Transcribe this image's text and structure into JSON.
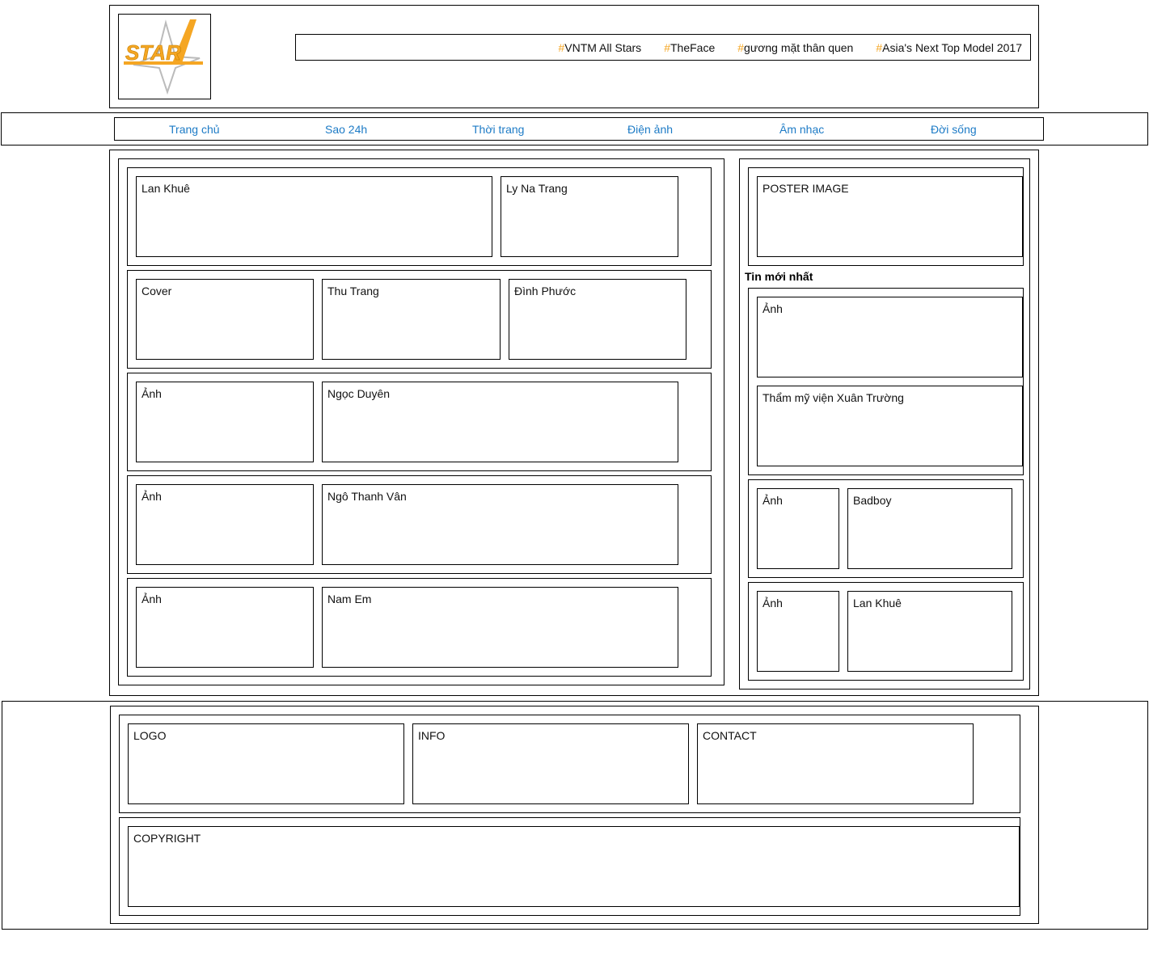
{
  "header": {
    "logo_text": "STAR",
    "hashtags": [
      "VNTM All Stars",
      "TheFace",
      "gương mặt thân quen",
      "Asia's Next Top Model 2017"
    ],
    "hash_symbol": "#",
    "accent_color": "#f5a623"
  },
  "nav": {
    "items": [
      "Trang chủ",
      "Sao 24h",
      "Thời trang",
      "Điện ảnh",
      "Âm nhạc",
      "Đời sống"
    ],
    "link_color": "#1d7bc6"
  },
  "main": {
    "row1": [
      "Lan Khuê",
      "Ly Na Trang"
    ],
    "row2": [
      "Cover",
      "Thu Trang",
      "Đình Phước"
    ],
    "row3": [
      "Ảnh",
      "Ngọc Duyên"
    ],
    "row4": [
      "Ảnh",
      "Ngô Thanh Vân"
    ],
    "row5": [
      "Ảnh",
      "Nam Em"
    ]
  },
  "sidebar": {
    "poster": "POSTER IMAGE",
    "latest_title": "Tin mới nhất",
    "news1_image": "Ảnh",
    "news1_title": "Thẩm mỹ viện Xuân Trường",
    "item2": [
      "Ảnh",
      "Badboy"
    ],
    "item3": [
      "Ảnh",
      "Lan Khuê"
    ]
  },
  "footer": {
    "logo": "LOGO",
    "info": "INFO",
    "contact": "CONTACT",
    "copyright": "COPYRIGHT"
  }
}
